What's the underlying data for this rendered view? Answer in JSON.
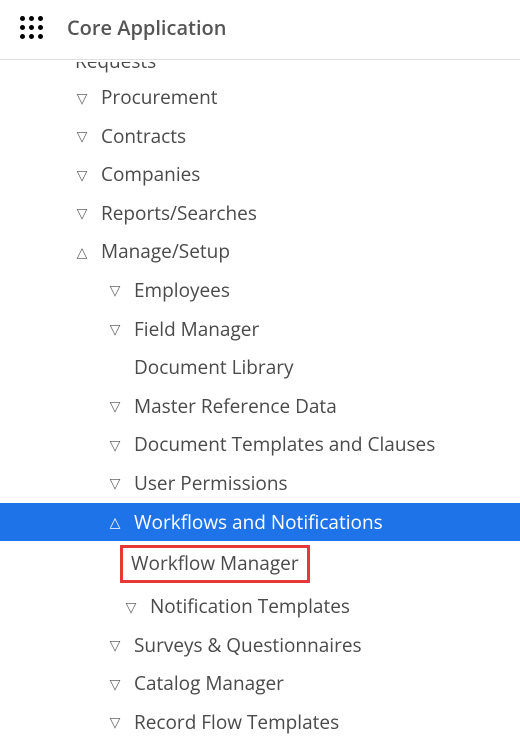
{
  "header": {
    "title": "Core Application"
  },
  "nav": {
    "cutoff_label": "Requests",
    "items": [
      {
        "label": "Procurement",
        "level": 0,
        "chev": "down"
      },
      {
        "label": "Contracts",
        "level": 0,
        "chev": "down"
      },
      {
        "label": "Companies",
        "level": 0,
        "chev": "down"
      },
      {
        "label": "Reports/Searches",
        "level": 0,
        "chev": "down"
      },
      {
        "label": "Manage/Setup",
        "level": 0,
        "chev": "up"
      },
      {
        "label": "Employees",
        "level": 1,
        "chev": "down"
      },
      {
        "label": "Field Manager",
        "level": 1,
        "chev": "down"
      },
      {
        "label": "Document Library",
        "level": 1,
        "chev": "none"
      },
      {
        "label": "Master Reference Data",
        "level": 1,
        "chev": "down"
      },
      {
        "label": "Document Templates and Clauses",
        "level": 1,
        "chev": "down"
      },
      {
        "label": "User Permissions",
        "level": 1,
        "chev": "down"
      },
      {
        "label": "Workflows and Notifications",
        "level": 1,
        "chev": "up",
        "selected": true
      },
      {
        "label": "Workflow Manager",
        "level": 2,
        "chev": "none",
        "boxed": true
      },
      {
        "label": "Notification Templates",
        "level": 2,
        "chev": "down"
      },
      {
        "label": "Surveys & Questionnaires",
        "level": 1,
        "chev": "down"
      },
      {
        "label": "Catalog Manager",
        "level": 1,
        "chev": "down"
      },
      {
        "label": "Record Flow Templates",
        "level": 1,
        "chev": "down"
      }
    ]
  }
}
